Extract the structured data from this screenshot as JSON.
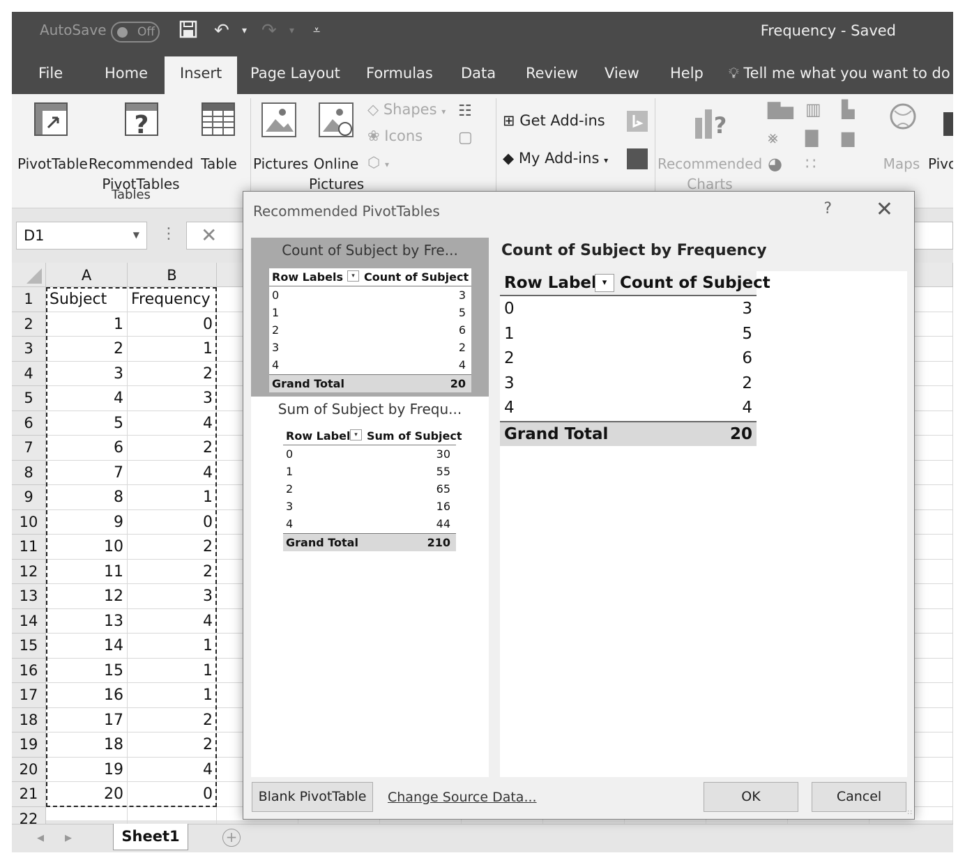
{
  "titlebar": {
    "autosave_label": "AutoSave",
    "autosave_state": "Off",
    "doc_title": "Frequency  -  Saved"
  },
  "tabs": [
    "File",
    "Home",
    "Insert",
    "Page Layout",
    "Formulas",
    "Data",
    "Review",
    "View",
    "Help"
  ],
  "active_tab": "Insert",
  "tell_me": "Tell me what you want to do",
  "ribbon": {
    "pivottable": "PivotTable",
    "recommended_line1": "Recommended",
    "recommended_line2": "PivotTables",
    "table": "Table",
    "tables_group": "Tables",
    "pictures": "Pictures",
    "online_line1": "Online",
    "online_line2": "Pictures",
    "shapes": "Shapes",
    "icons": "Icons",
    "get_addins": "Get Add-ins",
    "my_addins": "My Add-ins",
    "rec_charts_line1": "Recommended",
    "rec_charts_line2": "Charts",
    "maps": "Maps",
    "pivot_partial": "Pivo"
  },
  "namebox": "D1",
  "columns": [
    "A",
    "B"
  ],
  "sheet": {
    "headers": [
      "Subject",
      "Frequency"
    ],
    "rows": [
      [
        1,
        0
      ],
      [
        2,
        1
      ],
      [
        3,
        2
      ],
      [
        4,
        3
      ],
      [
        5,
        4
      ],
      [
        6,
        2
      ],
      [
        7,
        4
      ],
      [
        8,
        1
      ],
      [
        9,
        0
      ],
      [
        10,
        2
      ],
      [
        11,
        2
      ],
      [
        12,
        3
      ],
      [
        13,
        4
      ],
      [
        14,
        1
      ],
      [
        15,
        1
      ],
      [
        16,
        1
      ],
      [
        17,
        2
      ],
      [
        18,
        2
      ],
      [
        19,
        4
      ],
      [
        20,
        0
      ]
    ]
  },
  "row_numbers": [
    "1",
    "2",
    "3",
    "4",
    "5",
    "6",
    "7",
    "8",
    "9",
    "10",
    "11",
    "12",
    "13",
    "14",
    "15",
    "16",
    "17",
    "18",
    "19",
    "20",
    "21",
    "22"
  ],
  "sheet_tab": "Sheet1",
  "dialog": {
    "title": "Recommended PivotTables",
    "help": "?",
    "option1": {
      "title": "Count of Subject by Fre...",
      "col1": "Row Labels",
      "col2": "Count of Subject",
      "rows": [
        [
          "0",
          "3"
        ],
        [
          "1",
          "5"
        ],
        [
          "2",
          "6"
        ],
        [
          "3",
          "2"
        ],
        [
          "4",
          "4"
        ]
      ],
      "total_label": "Grand Total",
      "total_value": "20"
    },
    "option2": {
      "title": "Sum of Subject by Frequ...",
      "col1": "Row Labels",
      "col2": "Sum of Subject",
      "rows": [
        [
          "0",
          "30"
        ],
        [
          "1",
          "55"
        ],
        [
          "2",
          "65"
        ],
        [
          "3",
          "16"
        ],
        [
          "4",
          "44"
        ]
      ],
      "total_label": "Grand Total",
      "total_value": "210"
    },
    "preview": {
      "title": "Count of Subject by Frequency",
      "col1": "Row Labels",
      "col2": "Count of Subject",
      "rows": [
        [
          "0",
          "3"
        ],
        [
          "1",
          "5"
        ],
        [
          "2",
          "6"
        ],
        [
          "3",
          "2"
        ],
        [
          "4",
          "4"
        ]
      ],
      "total_label": "Grand Total",
      "total_value": "20"
    },
    "blank_pivot": "Blank PivotTable",
    "change_source": "Change Source Data...",
    "ok": "OK",
    "cancel": "Cancel"
  }
}
